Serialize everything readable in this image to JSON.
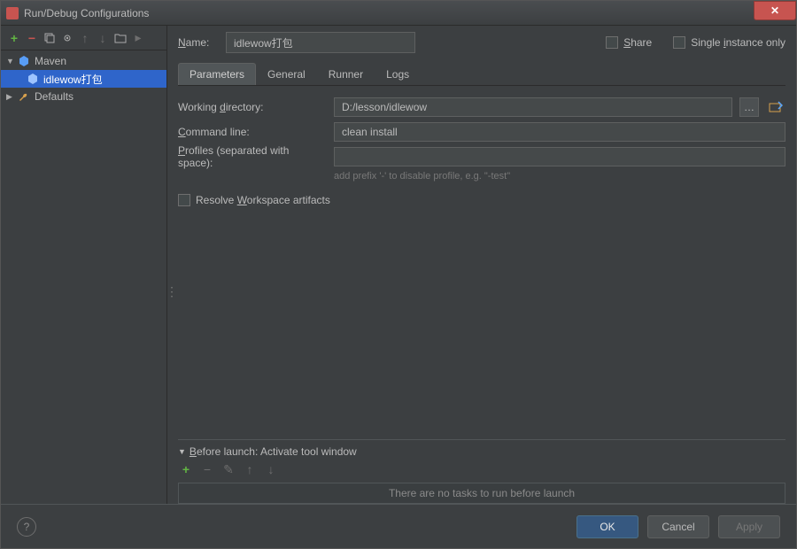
{
  "window": {
    "title": "Run/Debug Configurations"
  },
  "toolbar": {
    "add": "+",
    "remove": "−"
  },
  "tree": {
    "maven": {
      "label": "Maven",
      "expanded": true
    },
    "item": {
      "label": "idlewow打包"
    },
    "defaults": {
      "label": "Defaults",
      "expanded": false
    }
  },
  "form": {
    "name_label": "Name:",
    "name_value": "idlewow打包",
    "share_label": "Share",
    "single_instance_label": "Single instance only"
  },
  "tabs": {
    "parameters": "Parameters",
    "general": "General",
    "runner": "Runner",
    "logs": "Logs"
  },
  "params": {
    "working_dir_label": "Working directory:",
    "working_dir_value": "D:/lesson/idlewow",
    "command_line_label": "Command line:",
    "command_line_value": "clean install",
    "profiles_label": "Profiles (separated with space):",
    "profiles_value": "",
    "profiles_hint": "add prefix '-' to disable profile, e.g. \"-test\"",
    "resolve_label": "Resolve Workspace artifacts"
  },
  "before_launch": {
    "header": "Before launch: Activate tool window",
    "empty_msg": "There are no tasks to run before launch"
  },
  "footer": {
    "ok": "OK",
    "cancel": "Cancel",
    "apply": "Apply"
  }
}
